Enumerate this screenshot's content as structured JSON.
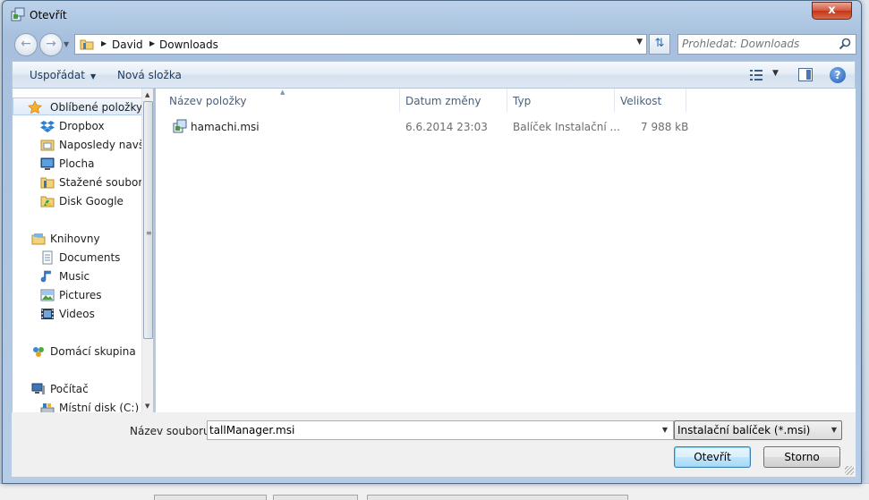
{
  "window": {
    "title": "Otevřít",
    "close_label": "x"
  },
  "address": {
    "crumbs": [
      "David",
      "Downloads"
    ]
  },
  "search": {
    "placeholder": "Prohledat: Downloads"
  },
  "toolbar": {
    "organize_label": "Uspořádat",
    "new_folder_label": "Nová složka"
  },
  "nav": {
    "favorites_header": "Oblíbené položky",
    "favorites": [
      "Dropbox",
      "Naposledy navšt",
      "Plocha",
      "Stažené soubory",
      "Disk Google"
    ],
    "libraries_header": "Knihovny",
    "libraries": [
      "Documents",
      "Music",
      "Pictures",
      "Videos"
    ],
    "homegroup": "Domácí skupina",
    "computer_header": "Počítač",
    "computer": [
      "Místní disk (C:)"
    ]
  },
  "columns": {
    "name": "Název položky",
    "date": "Datum změny",
    "type": "Typ",
    "size": "Velikost"
  },
  "files": [
    {
      "name": "hamachi.msi",
      "date": "6.6.2014 23:03",
      "type": "Balíček Instalační ...",
      "size": "7 988 kB"
    }
  ],
  "bottom": {
    "filename_label": "Název souboru:",
    "filename_value": "tallManager.msi",
    "filetype_value": "Instalační balíček (*.msi)",
    "open_label": "Otevřít",
    "cancel_label": "Storno"
  },
  "colors": {
    "accent": "#3c7fb1",
    "frame": "#a7c0dd",
    "close": "#c2361b"
  }
}
